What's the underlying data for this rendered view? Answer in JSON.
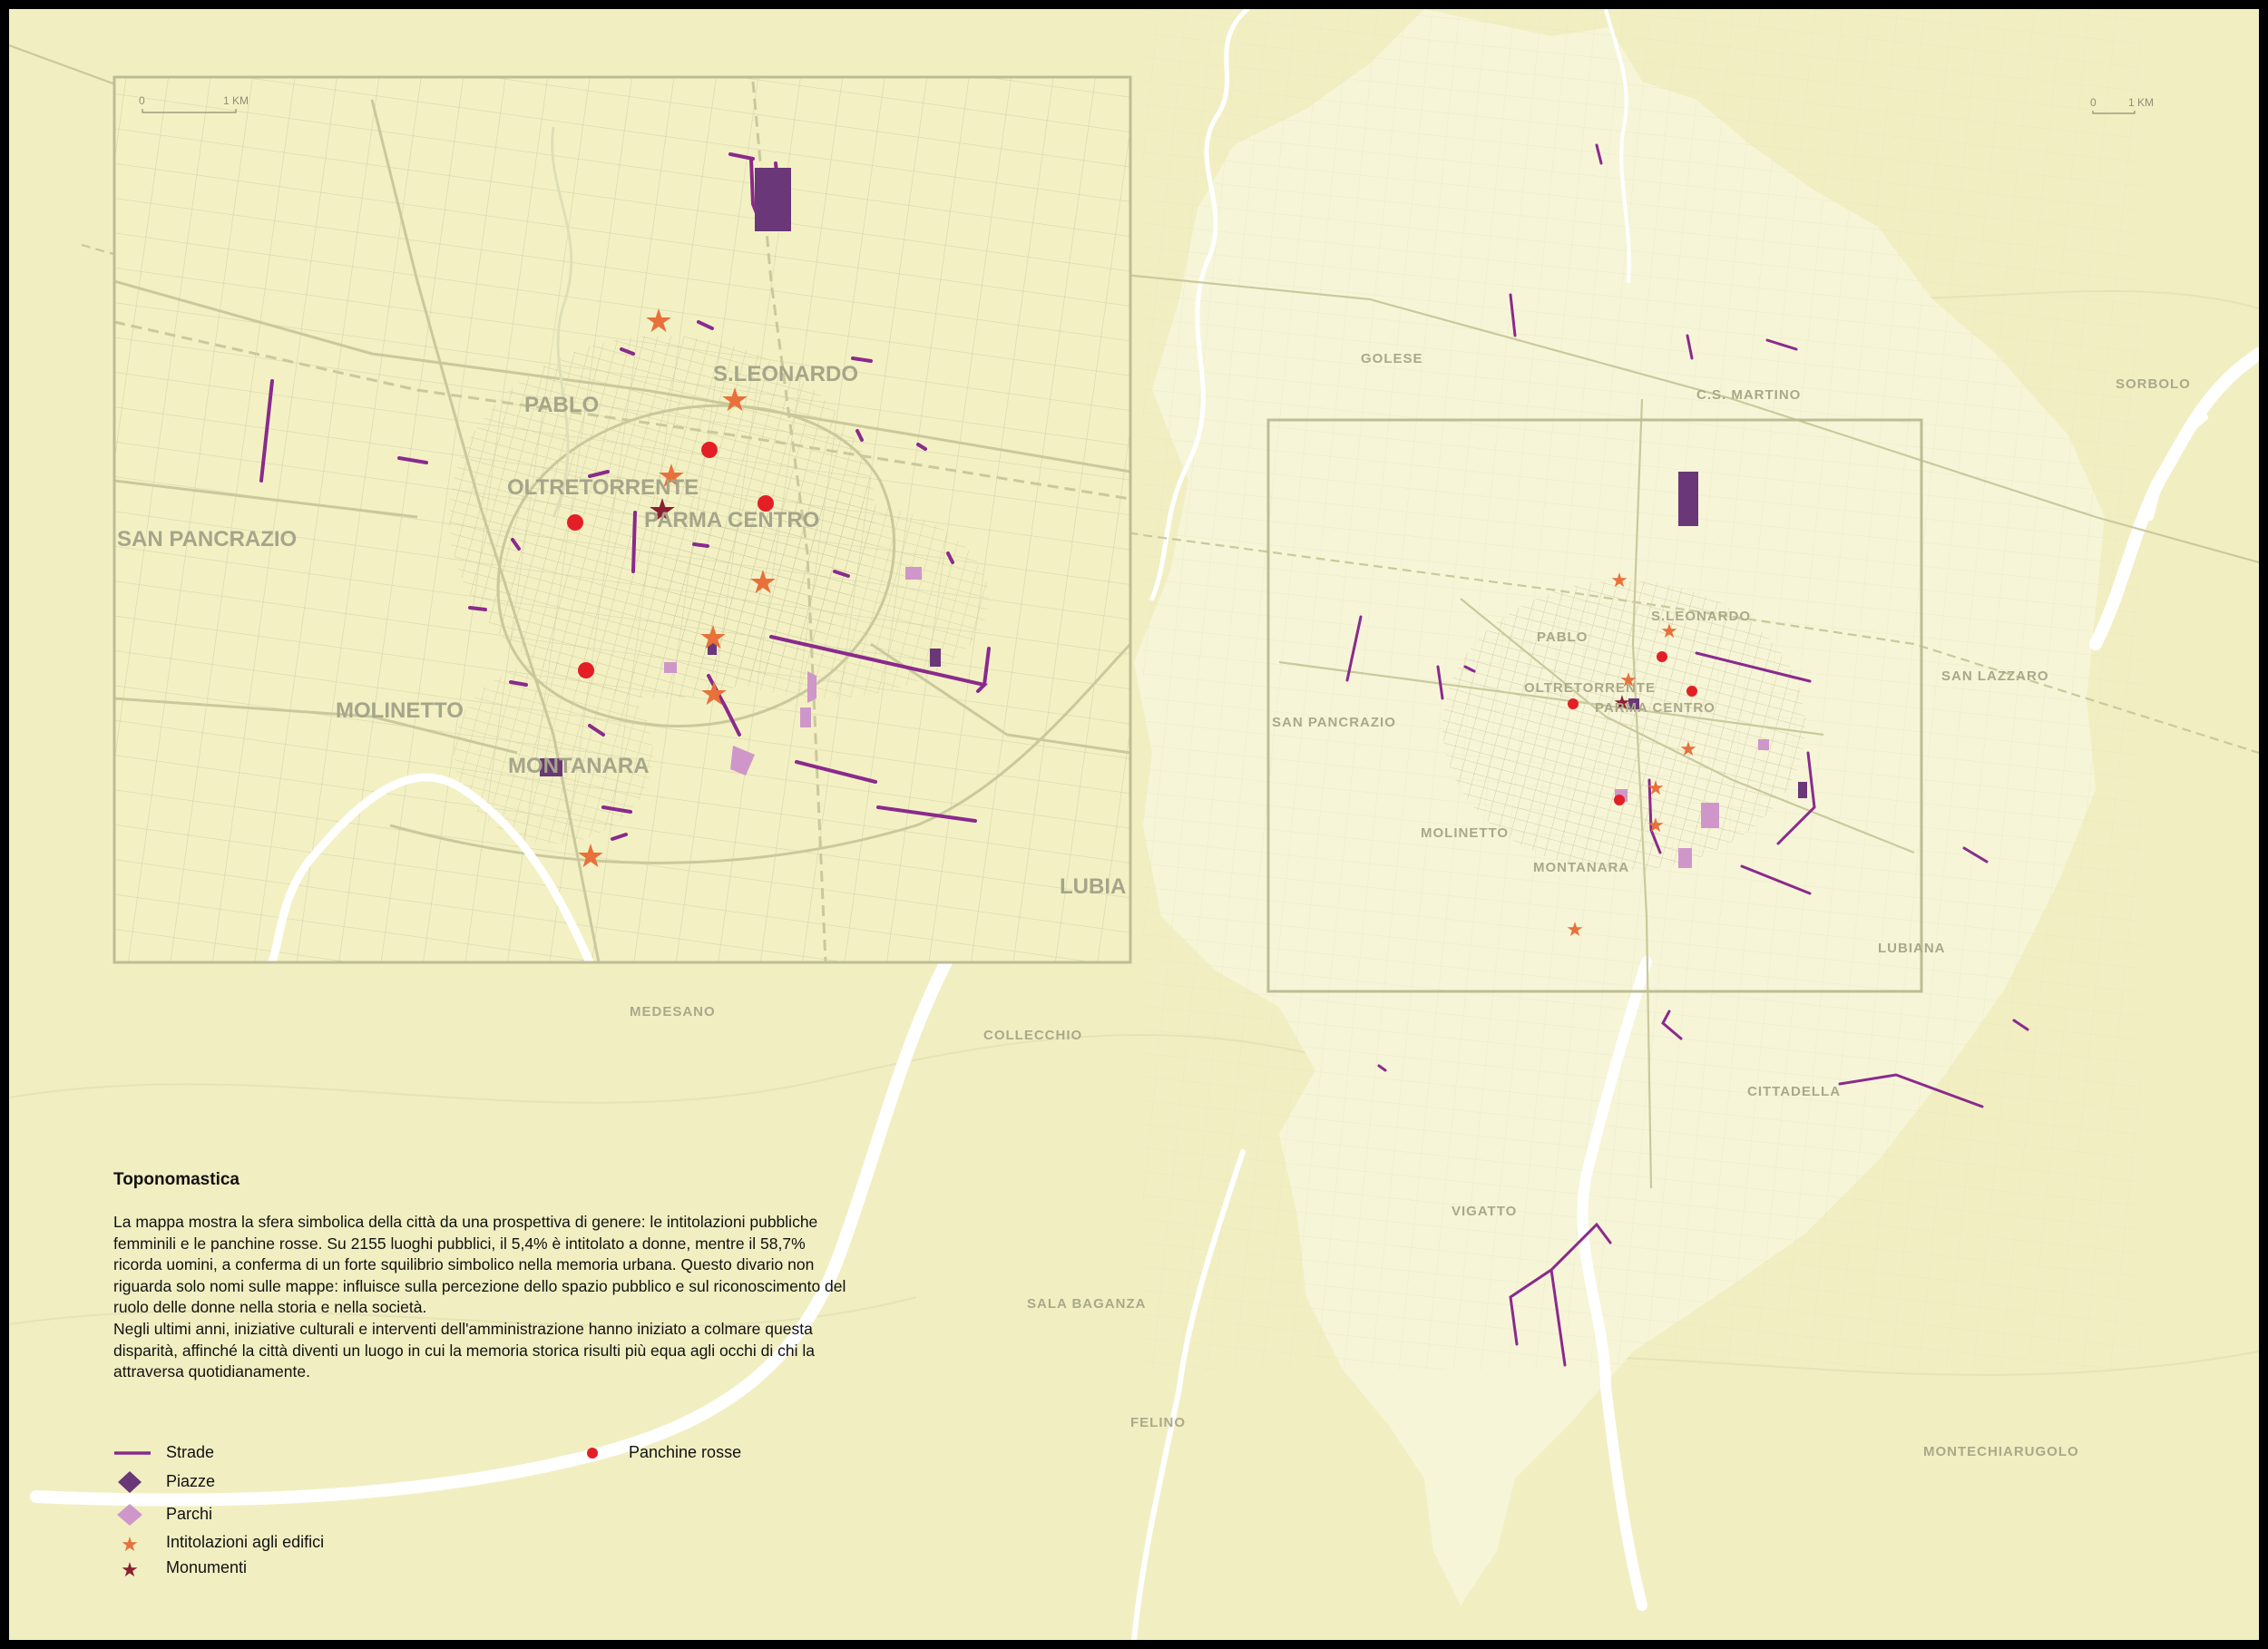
{
  "legend": {
    "title": "Toponomastica",
    "paragraph1": "La mappa mostra la sfera simbolica della città da una prospettiva di genere: le intitolazioni pubbliche femminili e le panchine rosse. Su 2155 luoghi pubblici, il 5,4% è intitolato a donne, mentre il 58,7% ricorda uomini, a conferma di un forte squilibrio simbolico nella memoria urbana. Questo divario non riguarda solo nomi sulle mappe: influisce sulla percezione dello spazio pubblico e sul riconoscimento del ruolo delle donne nella storia e nella società.",
    "paragraph2": "Negli ultimi anni, iniziative culturali e interventi dell'amministrazione hanno iniziato a colmare questa disparità, affinché la città diventi un luogo in cui la memoria storica risulti più equa agli occhi di chi la attraversa quotidianamente.",
    "items": {
      "strade": "Strade",
      "piazze": "Piazze",
      "parchi": "Parchi",
      "edifici": "Intitolazioni agli edifici",
      "monumenti": "Monumenti",
      "panchine": "Panchine rosse"
    }
  },
  "scale": {
    "zero": "0",
    "unit": "1 KM"
  },
  "inset_places": {
    "pablo": "PABLO",
    "sleonardo": "S.LEONARDO",
    "oltretorrente": "OLTRETORRENTE",
    "parmacentro": "PARMA CENTRO",
    "sanpancrazio": "SAN PANCRAZIO",
    "molinetto": "MOLINETTO",
    "montanara": "MONTANARA",
    "lubiana": "LUBIA"
  },
  "overview_places": {
    "golese": "GOLESE",
    "csmartino": "C.S. MARTINO",
    "sorbolo": "SORBOLO",
    "sanlazzaro": "SAN LAZZARO",
    "sleonardo": "S.LEONARDO",
    "pablo": "PABLO",
    "oltretorrente": "OLTRETORRENTE",
    "parmacentro": "PARMA CENTRO",
    "sanpancrazio": "SAN PANCRAZIO",
    "molinetto": "MOLINETTO",
    "montanara": "MONTANARA",
    "lubiana": "LUBIANA",
    "medesano": "MEDESANO",
    "collecchio": "COLLECCHIO",
    "cittadella": "CITTADELLA",
    "vigatto": "VIGATTO",
    "salabaganza": "SALA BAGANZA",
    "felino": "FELINO",
    "montechiarugolo": "MONTECHIARUGOLO"
  },
  "colors": {
    "background": "#f1efc2",
    "municipality": "#f7f5d8",
    "roads": "#c9c99c",
    "river": "#ffffff",
    "strade": "#8a2a8c",
    "piazze": "#6a3778",
    "parchi": "#cf97c9",
    "edifici": "#e8703a",
    "monumenti": "#8a2030",
    "panchine": "#e31f25"
  }
}
